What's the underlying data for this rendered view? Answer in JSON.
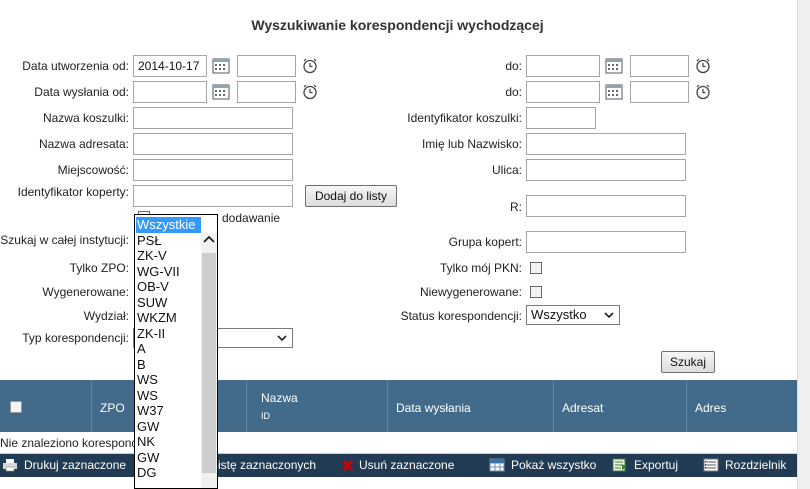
{
  "title": "Wyszukiwanie korespondencji wychodzącej",
  "form": {
    "data_utworzenia_od_label": "Data utworzenia od:",
    "data_utworzenia_od_value": "2014-10-17",
    "data_wyslania_od_label": "Data wysłania od:",
    "do_label_1": "do:",
    "do_label_2": "do:",
    "nazwa_koszulki_label": "Nazwa koszulki:",
    "identyfikator_koszulki_label": "Identyfikator koszulki:",
    "nazwa_adresata_label": "Nazwa adresata:",
    "imie_lub_nazwisko_label": "Imię lub Nazwisko:",
    "miejscowosc_label": "Miejscowość:",
    "ulica_label": "Ulica:",
    "identyfikator_koperty_label": "Identyfikator koperty:",
    "dodaj_do_listy_button": "Dodaj do listy",
    "dodawanie_label": "dodawanie",
    "r_label": "R:",
    "szukaj_w_calej_instytucji_label": "Szukaj w całej instytucji:",
    "grupa_kopert_label": "Grupa kopert:",
    "tylko_zpo_label": "Tylko ZPO:",
    "tylko_moj_pkn_label": "Tylko mój PKN:",
    "wygenerowane_label": "Wygenerowane:",
    "niewygenerowane_label": "Niewygenerowane:",
    "wydzial_label": "Wydział:",
    "status_korespondencji_label": "Status korespondencji:",
    "status_korespondencji_value": "Wszystko",
    "typ_korespondencji_label": "Typ korespondencji:",
    "szukaj_button": "Szukaj"
  },
  "dropdown": {
    "options": [
      "Wszystkie",
      "PSŁ",
      "ZK-V",
      "WG-VII",
      "OB-V",
      "SUW",
      "WKZM",
      "ZK-II",
      "A",
      "B",
      "WS",
      "WS",
      "W37",
      "GW",
      "NK",
      "GW",
      "DG"
    ],
    "selected_index": 0
  },
  "table": {
    "columns": {
      "zpo": "ZPO",
      "nazwa": "Nazwa",
      "id": "ID",
      "data_wyslania": "Data wysłania",
      "adresat": "Adresat",
      "adres": "Adres"
    },
    "empty_message": "Nie znaleziono korespond"
  },
  "footer": {
    "drukuj": "Drukuj zaznaczone",
    "liste_zaznaczonych": "istę zaznaczonych",
    "usun": "Usuń zaznaczone",
    "pokaz": "Pokaż wszystko",
    "exportuj": "Exportuj",
    "rozdzielnik": "Rozdzielnik"
  },
  "colors": {
    "header_bg": "#426b8b",
    "footer_bg": "#213b54",
    "dropdown_highlight": "#3399ff",
    "delete_icon": "#d40000"
  }
}
